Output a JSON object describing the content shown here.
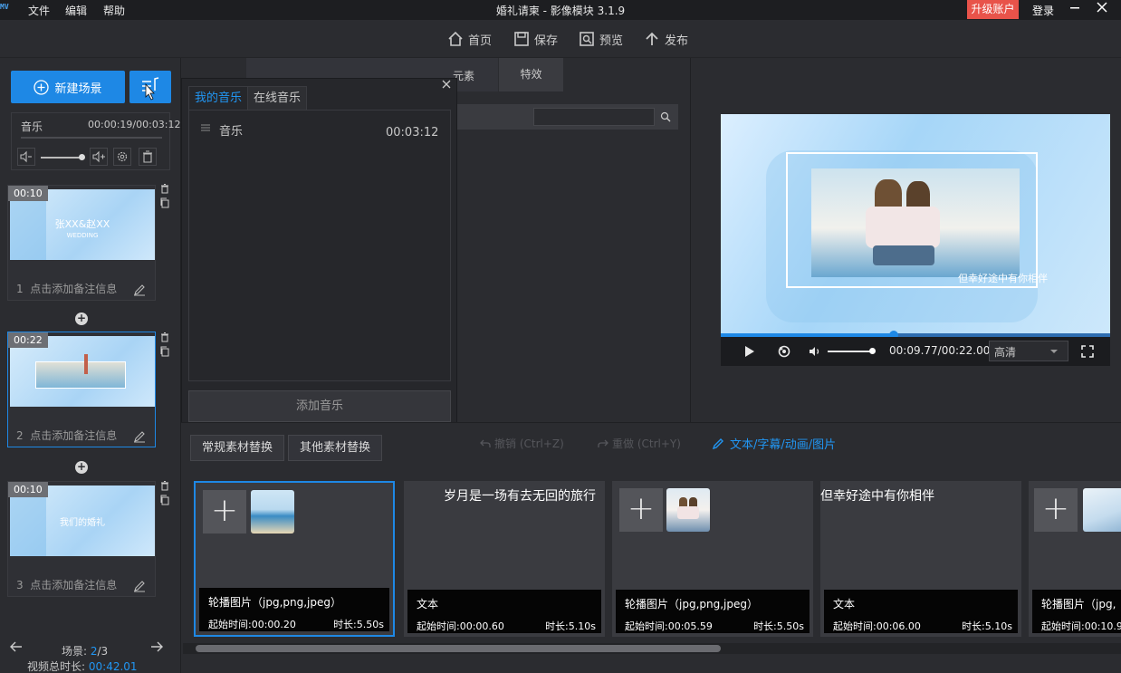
{
  "app": {
    "logo_text": "MV",
    "title": "婚礼请柬 - 影像模块 3.1.9",
    "menu": [
      "文件",
      "编辑",
      "帮助"
    ],
    "upgrade_label": "升级账户",
    "login_label": "登录",
    "accent": "#1e88e5",
    "upgrade_color": "#e8534a"
  },
  "toolbar": {
    "home": "首页",
    "save": "保存",
    "preview": "预览",
    "publish": "发布"
  },
  "left": {
    "new_scene": "新建场景",
    "music": {
      "label": "音乐",
      "time": "00:00:19/00:03:12"
    },
    "scenes": [
      {
        "index": "1",
        "duration": "00:10",
        "note": "点击添加备注信息",
        "thumb_text": "张XX&赵XX",
        "thumb_subtext": "WEDDING"
      },
      {
        "index": "2",
        "duration": "00:22",
        "note": "点击添加备注信息"
      },
      {
        "index": "3",
        "duration": "00:10",
        "note": "点击添加备注信息",
        "thumb_text": "我们的婚礼"
      }
    ],
    "footer": {
      "scene_label": "场景:",
      "scene_current": "2",
      "scene_total": "/3",
      "total_label": "视频总时长:",
      "total_value": "00:42.01"
    }
  },
  "music_popup": {
    "tab_my": "我的音乐",
    "tab_online": "在线音乐",
    "items": [
      {
        "name": "音乐",
        "duration": "00:03:12"
      }
    ],
    "add_button": "添加音乐"
  },
  "materials": {
    "tab_elements": "元素",
    "tab_effects": "特效"
  },
  "preview": {
    "caption": "但幸好途中有你相伴",
    "time": "00:09.77/00:22.00",
    "quality": "高清",
    "progress": 0.444
  },
  "bottom": {
    "tab_regular": "常规素材替换",
    "tab_other": "其他素材替换",
    "undo": "撤销 (Ctrl+Z)",
    "redo": "重做 (Ctrl+Y)",
    "text_link": "文本/字幕/动画/图片",
    "cards": [
      {
        "kind": "image",
        "type": "轮播图片（jpg,png,jpeg）",
        "start": "起始时间:00:00.20",
        "duration": "时长:5.50s"
      },
      {
        "kind": "text",
        "text": "岁月是一场有去无回的旅行",
        "type": "文本",
        "start": "起始时间:00:00.60",
        "duration": "时长:5.10s"
      },
      {
        "kind": "image",
        "type": "轮播图片（jpg,png,jpeg）",
        "start": "起始时间:00:05.59",
        "duration": "时长:5.50s"
      },
      {
        "kind": "text",
        "text": "但幸好途中有你相伴",
        "type": "文本",
        "start": "起始时间:00:06.00",
        "duration": "时长:5.10s"
      },
      {
        "kind": "image",
        "type": "轮播图片（jpg,",
        "start": "起始时间:00:10.9",
        "duration": ""
      }
    ]
  }
}
